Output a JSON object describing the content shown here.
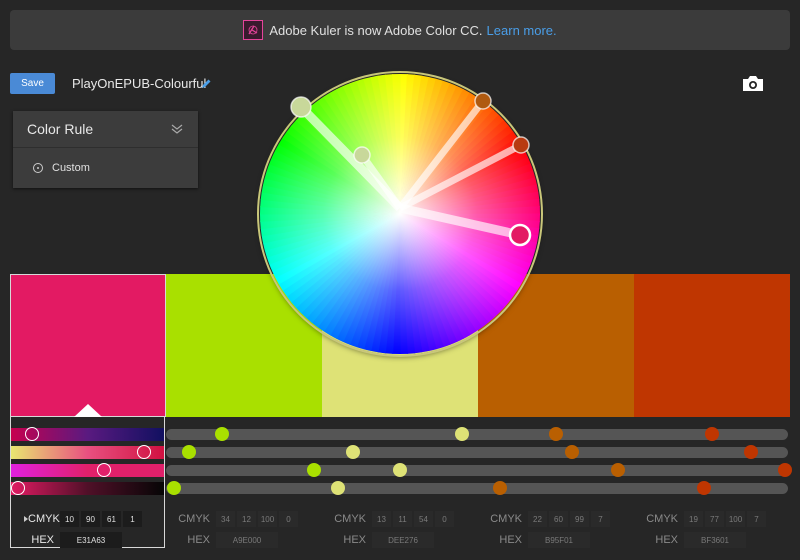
{
  "banner": {
    "text": "Adobe Kuler is now Adobe Color CC.",
    "link": "Learn more.",
    "icon": "kuler-logo-icon"
  },
  "toolbar": {
    "save_label": "Save",
    "theme_name": "PlayOnEPUB-Colourful",
    "edit_icon": "pencil-icon",
    "camera_icon": "camera-icon"
  },
  "color_rule": {
    "title": "Color Rule",
    "option": "Custom",
    "collapse_icon": "double-chevron-icon",
    "radio_icon": "radio-icon"
  },
  "swatches": [
    {
      "color": "#E31A63",
      "cmyk": [
        "10",
        "90",
        "61",
        "1"
      ],
      "hex": "E31A63",
      "slider_fraction": [
        0.14,
        0.86,
        0.6,
        0.05
      ],
      "active": true
    },
    {
      "color": "#A9E000",
      "cmyk": [
        "34",
        "12",
        "100",
        "0"
      ],
      "hex": "A9E000",
      "slider_fraction": [
        0.36,
        0.15,
        0.95,
        0.05
      ]
    },
    {
      "color": "#DEE276",
      "cmyk": [
        "13",
        "11",
        "54",
        "0"
      ],
      "hex": "DEE276",
      "slider_fraction": [
        0.9,
        0.2,
        0.5,
        0.1
      ]
    },
    {
      "color": "#B95F01",
      "cmyk": [
        "22",
        "60",
        "99",
        "7"
      ],
      "hex": "B95F01",
      "slider_fraction": [
        0.5,
        0.6,
        0.9,
        0.14
      ]
    },
    {
      "color": "#BF3601",
      "cmyk": [
        "19",
        "77",
        "100",
        "7"
      ],
      "hex": "BF3601",
      "slider_fraction": [
        0.5,
        0.75,
        0.97,
        0.45
      ]
    }
  ],
  "labels": {
    "cmyk": "CMYK",
    "hex": "HEX"
  }
}
